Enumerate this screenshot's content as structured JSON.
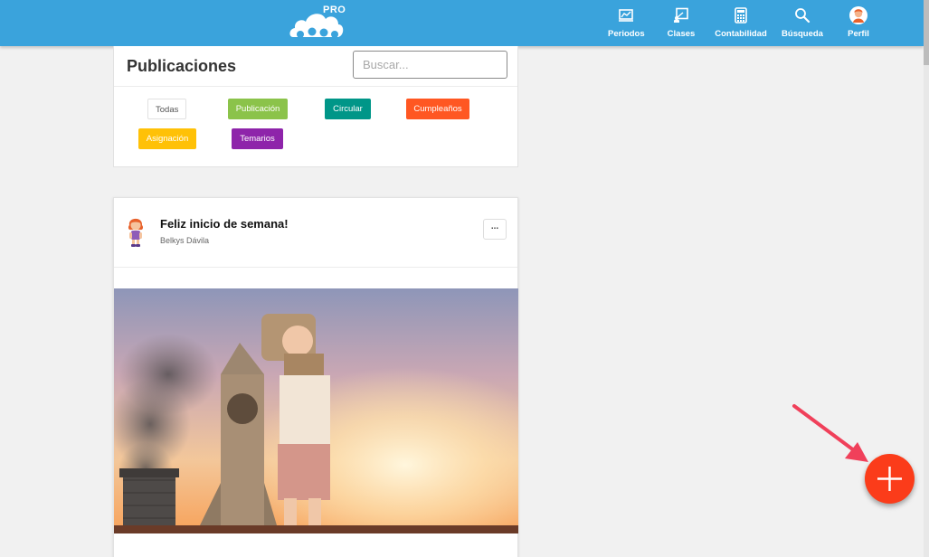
{
  "header": {
    "logo_badge": "PRO",
    "nav": [
      {
        "label": "Periodos",
        "icon": "chart-icon"
      },
      {
        "label": "Clases",
        "icon": "presentation-icon"
      },
      {
        "label": "Contabilidad",
        "icon": "calculator-icon"
      },
      {
        "label": "Búsqueda",
        "icon": "search-icon"
      },
      {
        "label": "Perfil",
        "icon": "avatar-icon"
      }
    ]
  },
  "publications": {
    "title": "Publicaciones",
    "search_placeholder": "Buscar...",
    "filters": [
      {
        "label": "Todas",
        "color": "#ffffff"
      },
      {
        "label": "Publicación",
        "color": "#8bc34a"
      },
      {
        "label": "Circular",
        "color": "#009688"
      },
      {
        "label": "Cumpleaños",
        "color": "#ff5722"
      },
      {
        "label": "Asignación",
        "color": "#ffc107"
      },
      {
        "label": "Temarios",
        "color": "#8e24aa"
      }
    ]
  },
  "post": {
    "title": "Feliz inicio de semana!",
    "author": "Belkys Dávila",
    "more_label": "...",
    "image_icon": "photo-child-astronaut"
  },
  "colors": {
    "topbar": "#3aa3dc",
    "fab": "#fb3c1a",
    "arrow": "#f0405a"
  }
}
